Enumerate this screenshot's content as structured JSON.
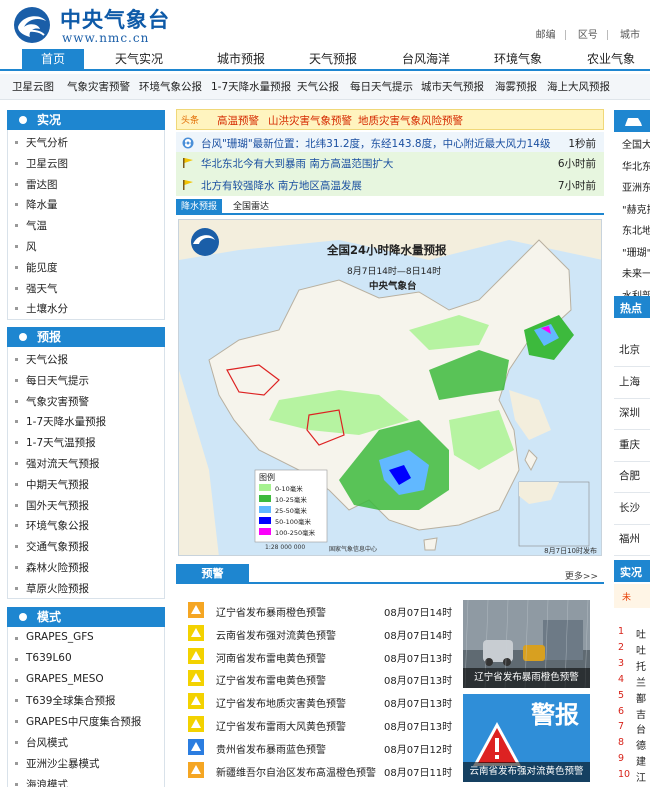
{
  "header": {
    "logo_cn": "中央气象台",
    "logo_en": "www.nmc.cn",
    "top_links": [
      "邮编",
      "区号",
      "城市"
    ]
  },
  "mainnav": [
    "首页",
    "天气实况",
    "城市预报",
    "天气预报",
    "台风海洋",
    "环境气象",
    "农业气象"
  ],
  "subnav": [
    "卫星云图",
    "气象灾害预警",
    "环境气象公报",
    "1-7天降水量预报",
    "天气公报",
    "每日天气提示",
    "城市天气预报",
    "海雾预报",
    "海上大风预报"
  ],
  "sidebar": {
    "shikuang": {
      "title": "实况",
      "items": [
        "天气分析",
        "卫星云图",
        "雷达图",
        "降水量",
        "气温",
        "风",
        "能见度",
        "强天气",
        "土壤水分"
      ]
    },
    "yubao": {
      "title": "预报",
      "items": [
        "天气公报",
        "每日天气提示",
        "气象灾害预警",
        "1-7天降水量预报",
        "1-7天气温预报",
        "强对流天气预报",
        "中期天气预报",
        "国外天气预报",
        "环境气象公报",
        "交通气象预报",
        "森林火险预报",
        "草原火险预报"
      ]
    },
    "moshi": {
      "title": "模式",
      "items": [
        "GRAPES_GFS",
        "T639L60",
        "GRAPES_MESO",
        "T639全球集合预报",
        "GRAPES中尺度集合预报",
        "台风模式",
        "亚洲沙尘暴模式",
        "海浪模式"
      ]
    }
  },
  "headline": {
    "label": "头条",
    "items": [
      "高温预警",
      "山洪灾害气象预警",
      "地质灾害气象风险预警"
    ]
  },
  "news": [
    {
      "title": "台风\"珊瑚\"最新位置：北纬31.2度，东经143.8度，中心附近最大风力14级",
      "time": "1秒前"
    },
    {
      "title": "华北东北今有大到暴雨 南方高温范围扩大",
      "time": "6小时前"
    },
    {
      "title": "北方有较强降水 南方地区高温发展",
      "time": "7小时前"
    }
  ],
  "tabs": [
    "降水预报",
    "全国雷达"
  ],
  "map": {
    "title": "全国24小时降水量预报",
    "subtitle": "8月7日14时—8日14时",
    "org": "中央气象台",
    "legend_title": "图例",
    "legend": [
      {
        "label": "0-10毫米",
        "color": "#a6f28f"
      },
      {
        "label": "10-25毫米",
        "color": "#3dba3d"
      },
      {
        "label": "25-50毫米",
        "color": "#61b8ff"
      },
      {
        "label": "50-100毫米",
        "color": "#0000ff"
      },
      {
        "label": "100-250毫米",
        "color": "#fa00fa"
      }
    ],
    "scale": "1:28 000 000",
    "footer_org": "国家气象信息中心",
    "issued": "8月7日10时发布"
  },
  "warnings": {
    "label": "预警",
    "more": "更多>>",
    "items": [
      {
        "title": "辽宁省发布暴雨橙色预警",
        "time": "08月07日14时",
        "color": "#f5a623"
      },
      {
        "title": "云南省发布强对流黄色预警",
        "time": "08月07日14时",
        "color": "#f3d200"
      },
      {
        "title": "河南省发布雷电黄色预警",
        "time": "08月07日13时",
        "color": "#f3d200"
      },
      {
        "title": "辽宁省发布雷电黄色预警",
        "time": "08月07日13时",
        "color": "#f3d200"
      },
      {
        "title": "辽宁省发布地质灾害黄色预警",
        "time": "08月07日13时",
        "color": "#f3d200"
      },
      {
        "title": "辽宁省发布雷雨大风黄色预警",
        "time": "08月07日13时",
        "color": "#f3d200"
      },
      {
        "title": "贵州省发布暴雨蓝色预警",
        "time": "08月07日12时",
        "color": "#2b7de0"
      },
      {
        "title": "新疆维吾尔自治区发布高温橙色预警",
        "time": "08月07日11时",
        "color": "#f5a623"
      }
    ],
    "photos": [
      "辽宁省发布暴雨橙色预警",
      "云南省发布强对流黄色预警"
    ],
    "photo2_text": "警报"
  },
  "rightcol": {
    "news": [
      "全国大",
      "华北东",
      "亚洲东",
      "\"赫克拉",
      "东北地",
      "\"珊瑚\"",
      "未来一",
      "水利部"
    ],
    "hot_label": "热点",
    "cities": [
      "北京",
      "上海",
      "深圳",
      "重庆",
      "合肥",
      "长沙",
      "福州"
    ],
    "live_label": "实况",
    "ranking_label": "未",
    "ranking": [
      {
        "n": "1",
        "c": "吐"
      },
      {
        "n": "2",
        "c": "吐"
      },
      {
        "n": "3",
        "c": "托"
      },
      {
        "n": "4",
        "c": "兰"
      },
      {
        "n": "5",
        "c": "鄯"
      },
      {
        "n": "6",
        "c": "吉"
      },
      {
        "n": "7",
        "c": "台"
      },
      {
        "n": "8",
        "c": "德"
      },
      {
        "n": "9",
        "c": "建"
      },
      {
        "n": "10",
        "c": "江"
      }
    ]
  },
  "colors": {
    "primary": "#1e86d0",
    "headline_text": "#d52a00",
    "news_link": "#1a4fa0"
  }
}
